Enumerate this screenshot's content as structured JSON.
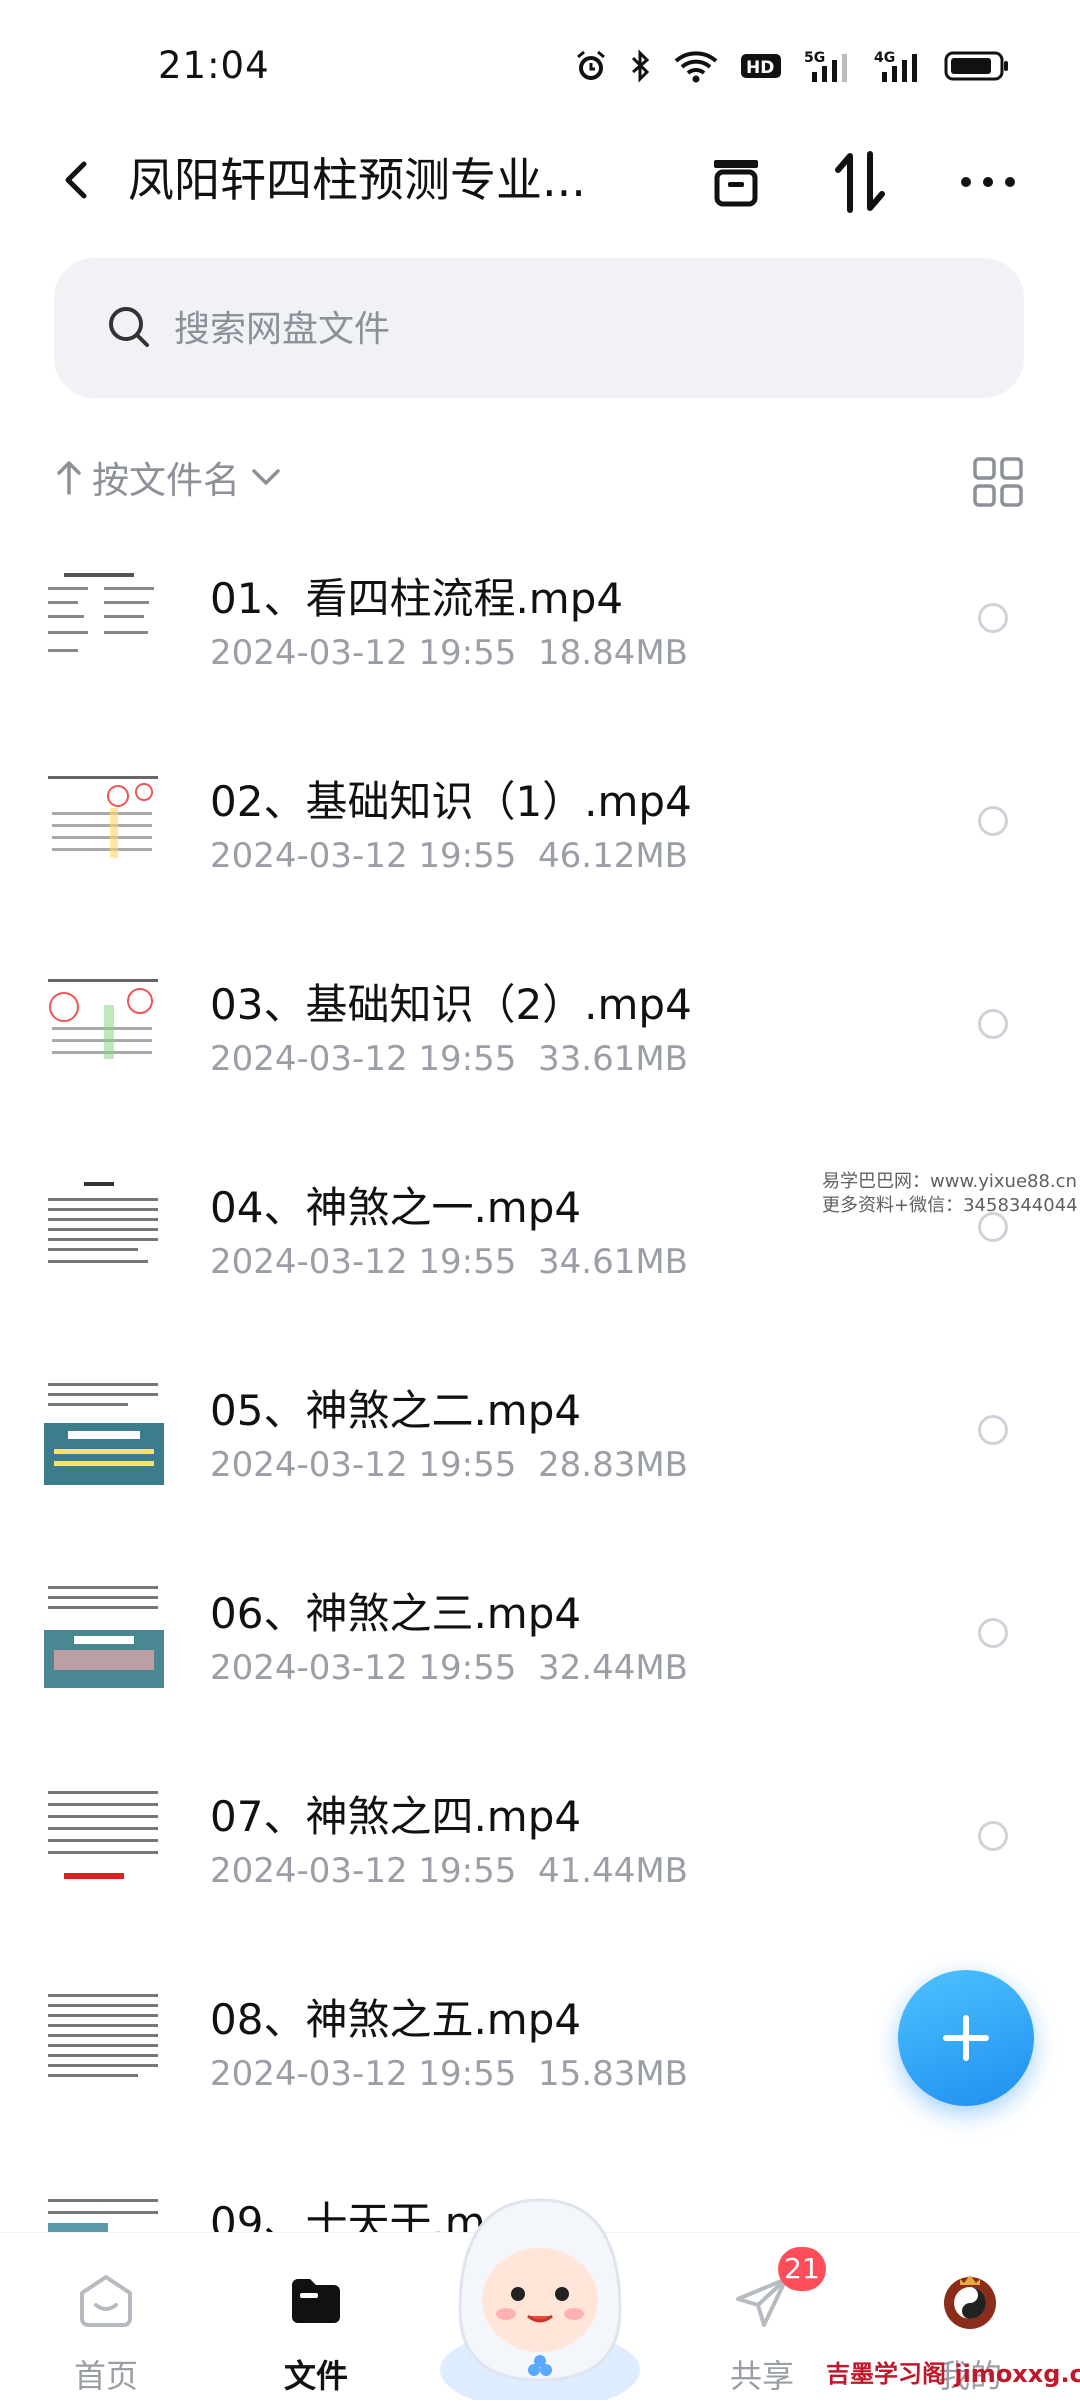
{
  "status": {
    "time": "21:04",
    "icons": [
      "alarm-icon",
      "bluetooth-icon",
      "wifi-icon",
      "hd-icon",
      "5g-signal-icon",
      "4g-signal-icon",
      "battery-icon"
    ]
  },
  "header": {
    "title": "凤阳轩四柱预测专业...",
    "icons": [
      "back-icon",
      "recycle-bin-icon",
      "sort-transfer-icon",
      "more-icon"
    ]
  },
  "search": {
    "placeholder": "搜索网盘文件"
  },
  "sort": {
    "label": "按文件名"
  },
  "files": [
    {
      "name": "01、看四柱流程.mp4",
      "date": "2024-03-12  19:55",
      "size": "18.84MB"
    },
    {
      "name": "02、基础知识（1）.mp4",
      "date": "2024-03-12  19:55",
      "size": "46.12MB"
    },
    {
      "name": "03、基础知识（2）.mp4",
      "date": "2024-03-12  19:55",
      "size": "33.61MB"
    },
    {
      "name": "04、神煞之一.mp4",
      "date": "2024-03-12  19:55",
      "size": "34.61MB"
    },
    {
      "name": "05、神煞之二.mp4",
      "date": "2024-03-12  19:55",
      "size": "28.83MB"
    },
    {
      "name": "06、神煞之三.mp4",
      "date": "2024-03-12  19:55",
      "size": "32.44MB"
    },
    {
      "name": "07、神煞之四.mp4",
      "date": "2024-03-12  19:55",
      "size": "41.44MB"
    },
    {
      "name": "08、神煞之五.mp4",
      "date": "2024-03-12  19:55",
      "size": "15.83MB"
    },
    {
      "name": "09、十天干.m",
      "date": "",
      "size": ""
    }
  ],
  "watermark": {
    "line1": "易学巴巴网：www.yixue88.cn",
    "line2": "更多资料+微信：3458344044",
    "bottom": "吉墨学习阁 jimoxxg.com"
  },
  "nav": {
    "home": "首页",
    "files": "文件",
    "share": "共享",
    "share_badge": "21",
    "me": "我的"
  },
  "colors": {
    "accent": "#1e8ff0",
    "badge": "#ff4d5a",
    "muted": "#9a9ea6"
  }
}
